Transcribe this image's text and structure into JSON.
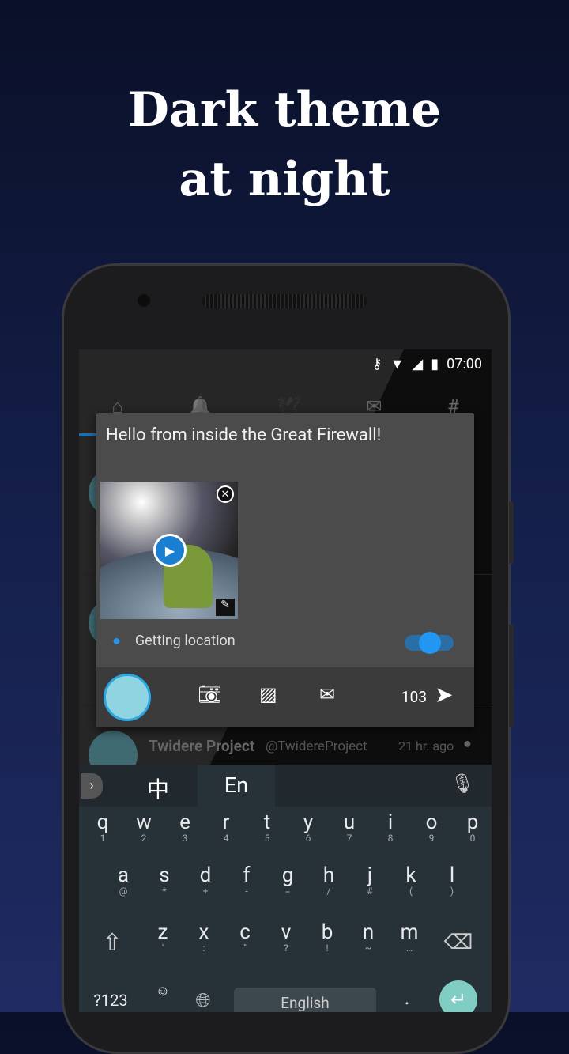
{
  "headline": [
    "Dark theme",
    "at night"
  ],
  "status": {
    "time": "07:00",
    "icons": [
      "vpn-key-icon",
      "wifi-icon",
      "signal-icon",
      "battery-icon"
    ]
  },
  "tabs": [
    {
      "icon": "home-icon",
      "glyph": "⌂"
    },
    {
      "icon": "bell-icon",
      "glyph": "🔔"
    },
    {
      "icon": "bird-icon",
      "glyph": "🕊"
    },
    {
      "icon": "mail-icon",
      "glyph": "✉"
    },
    {
      "icon": "hashtag-icon",
      "glyph": "#"
    }
  ],
  "compose": {
    "text": "Hello from inside the Great Firewall!",
    "location": "Getting location",
    "location_enabled": true,
    "char_count": "103"
  },
  "timeline": {
    "name": "Twidere Project",
    "handle": "@TwidereProject",
    "time": "21 hr. ago"
  },
  "keyboard": {
    "lang_cn": "中",
    "lang_en": "En",
    "row1": [
      [
        "q",
        "1"
      ],
      [
        "w",
        "2"
      ],
      [
        "e",
        "3"
      ],
      [
        "r",
        "4"
      ],
      [
        "t",
        "5"
      ],
      [
        "y",
        "6"
      ],
      [
        "u",
        "7"
      ],
      [
        "i",
        "8"
      ],
      [
        "o",
        "9"
      ],
      [
        "p",
        "0"
      ]
    ],
    "row2": [
      [
        "a",
        "@"
      ],
      [
        "s",
        "*"
      ],
      [
        "d",
        "+"
      ],
      [
        "f",
        "-"
      ],
      [
        "g",
        "="
      ],
      [
        "h",
        "/"
      ],
      [
        "j",
        "#"
      ],
      [
        "k",
        "("
      ],
      [
        "l",
        ")"
      ]
    ],
    "row3": [
      [
        "z",
        "'"
      ],
      [
        "x",
        ":"
      ],
      [
        "c",
        "\""
      ],
      [
        "v",
        "?"
      ],
      [
        "b",
        "!"
      ],
      [
        "n",
        "~"
      ],
      [
        "m",
        "…"
      ]
    ],
    "symbols": "?123",
    "space": "English",
    "period": "."
  },
  "colors": {
    "accent": "#2196f3",
    "enter": "#7fcdc3",
    "card": "#4b4b4b"
  }
}
